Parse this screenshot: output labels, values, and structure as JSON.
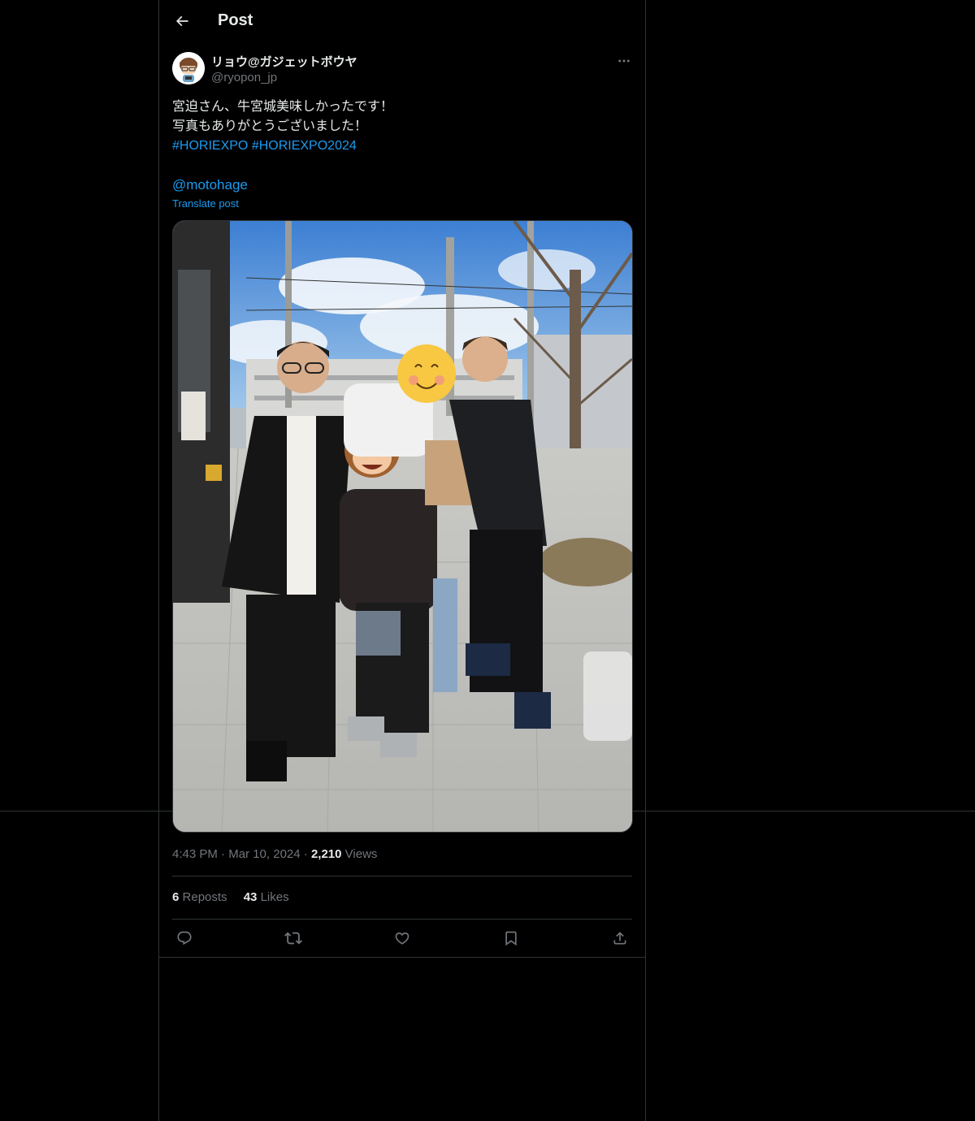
{
  "header": {
    "title": "Post",
    "back_icon": "arrow-left-icon"
  },
  "author": {
    "display_name": "リョウ@ガジェットボウヤ",
    "handle": "@ryopon_jp"
  },
  "post": {
    "text_lines": [
      "宮迫さん、牛宮城美味しかったです！",
      "写真もありがとうございました！"
    ],
    "hashtags": [
      "#HORIEXPO",
      "#HORIEXPO2024"
    ],
    "mention": "@motohage",
    "translate_label": "Translate post",
    "time": "4:43 PM",
    "date": "Mar 10, 2024",
    "separator": "·",
    "views_count": "2,210",
    "views_label": "Views"
  },
  "stats": {
    "reposts_count": "6",
    "reposts_label": "Reposts",
    "likes_count": "43",
    "likes_label": "Likes"
  },
  "actions": {
    "reply_icon": "reply-icon",
    "repost_icon": "repost-icon",
    "like_icon": "heart-icon",
    "bookmark_icon": "bookmark-icon",
    "share_icon": "share-icon"
  },
  "colors": {
    "background": "#000000",
    "text": "#e7e9ea",
    "muted": "#71767b",
    "link": "#1d9bf0",
    "border": "#2f3336"
  }
}
